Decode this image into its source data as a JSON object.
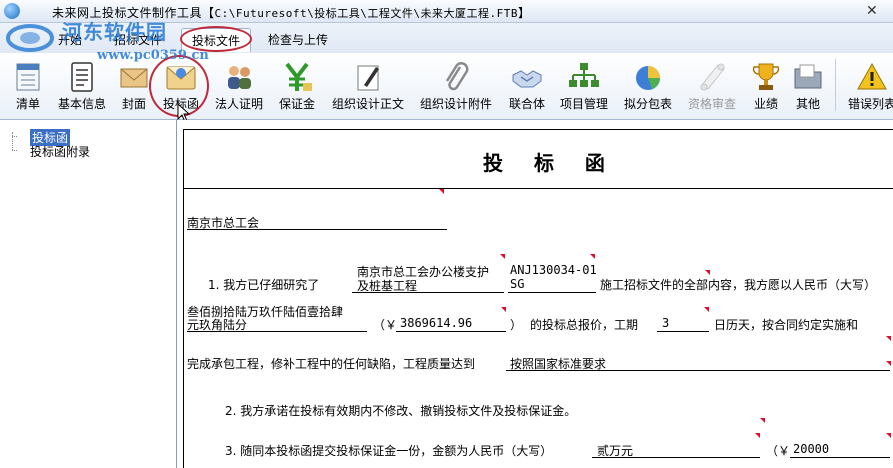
{
  "window": {
    "title_prefix": "未来网上投标文件制作工具【",
    "title_path": "C:\\Futuresoft\\投标工具\\工程文件\\未来大厦工程.FTB",
    "title_suffix": "】",
    "close_glyph": "✕"
  },
  "watermark": {
    "title": "河东软件园",
    "url": "www.pc0359.cn"
  },
  "tabs": [
    {
      "label": "开始"
    },
    {
      "label": "招标文件"
    },
    {
      "label": "投标文件"
    },
    {
      "label": "检查与上传"
    }
  ],
  "ribbon": [
    {
      "label": "清单",
      "icon": "list-icon"
    },
    {
      "label": "基本信息",
      "icon": "document-icon"
    },
    {
      "label": "封面",
      "icon": "envelope-icon"
    },
    {
      "label": "投标函",
      "icon": "letter-icon"
    },
    {
      "label": "法人证明",
      "icon": "people-icon"
    },
    {
      "label": "保证金",
      "icon": "yen-icon"
    },
    {
      "label": "组织设计正文",
      "icon": "pen-icon"
    },
    {
      "label": "组织设计附件",
      "icon": "paperclip-icon"
    },
    {
      "label": "联合体",
      "icon": "handshake-icon"
    },
    {
      "label": "项目管理",
      "icon": "org-chart-icon"
    },
    {
      "label": "拟分包表",
      "icon": "pie-chart-icon"
    },
    {
      "label": "资格审查",
      "icon": "scroll-icon"
    },
    {
      "label": "业绩",
      "icon": "trophy-icon"
    },
    {
      "label": "其他",
      "icon": "folder-icon"
    },
    {
      "label": "错误列表",
      "icon": "warning-icon"
    }
  ],
  "tree": {
    "items": [
      "投标函",
      "投标函附录"
    ]
  },
  "doc": {
    "title": "投 标 函",
    "recipient": "南京市总工会",
    "p1_intro": "1. 我方已仔细研究了",
    "p1_project_line1": "南京市总工会办公楼支护",
    "p1_project_line2": "及桩基工程",
    "p1_code_line1": "ANJ130034-01",
    "p1_code_line2": "SG",
    "p1_tail": "施工招标文件的全部内容，我方愿以人民币（大写）",
    "amount_words_line1": "叁佰捌拾陆万玖仟陆佰壹拾肆",
    "amount_words_line2": "元玖角陆分",
    "yen_open": "（￥",
    "amount_number": "3869614.96",
    "paren_close": "）",
    "quote_text": "的投标总报价，工期",
    "duration": "3",
    "duration_tail": "日历天，按合同约定实施和",
    "p1_cont": "完成承包工程，修补工程中的任何缺陷，工程质量达到",
    "quality": "按照国家标准要求",
    "p2": "2. 我方承诺在投标有效期内不修改、撤销投标文件及投标保证金。",
    "p3_intro": "3. 随同本投标函提交投标保证金一份，金额为人民币（大写）",
    "deposit_words": "贰万元",
    "yen_open2": "（￥",
    "deposit_number": "20000"
  }
}
